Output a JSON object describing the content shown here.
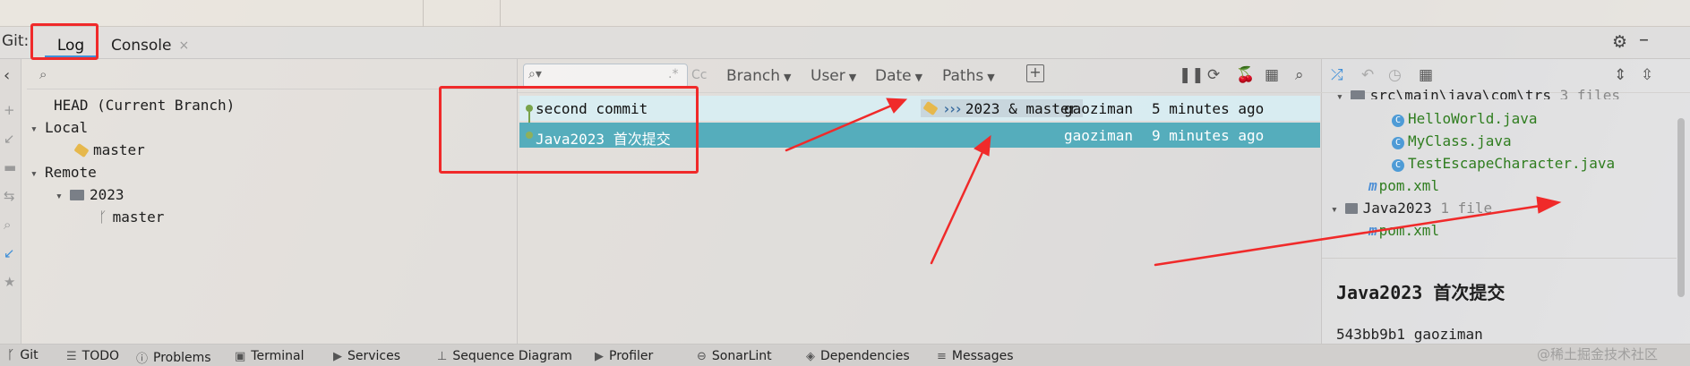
{
  "tool_window": {
    "label": "Git:",
    "tabs": [
      {
        "label": "Log",
        "active": true
      },
      {
        "label": "Console",
        "close": "×"
      }
    ]
  },
  "branches": {
    "head": "HEAD (Current Branch)",
    "local_label": "Local",
    "local_items": [
      "master"
    ],
    "remote_label": "Remote",
    "remote_groups": [
      {
        "name": "2023",
        "items": [
          "master"
        ]
      }
    ]
  },
  "log": {
    "filters": [
      "Branch",
      "User",
      "Date",
      "Paths"
    ],
    "search_icons": {
      "regex": ".*",
      "case": "Cc"
    },
    "commits": [
      {
        "subject": "second commit",
        "refs": "2023 & master",
        "author": "gaoziman",
        "date": "5 minutes ago",
        "selected": false
      },
      {
        "subject": "Java2023 首次提交",
        "refs": "",
        "author": "gaoziman",
        "date": "9 minutes ago",
        "selected": true
      }
    ]
  },
  "details": {
    "tree": {
      "path": "src\\main\\java\\com\\trs",
      "path_count": "3 files",
      "files": [
        "HelloWorld.java",
        "MyClass.java",
        "TestEscapeCharacter.java"
      ],
      "pom1": "pom.xml",
      "module": "Java2023",
      "module_count": "1 file",
      "pom2": "pom.xml"
    },
    "commit_title": "Java2023 首次提交",
    "commit_meta": "543bb9b1 gaoziman"
  },
  "statusbar": {
    "items": [
      "Git",
      "TODO",
      "Problems",
      "Terminal",
      "Services",
      "Sequence Diagram",
      "Profiler",
      "SonarLint",
      "Dependencies",
      "Messages"
    ]
  },
  "watermark": "@稀土掘金技术社区",
  "colors": {
    "accent": "#3f8fd8",
    "selected_row": "#55adbc",
    "annotation_red": "#f02a2a",
    "java_green": "#2f7d1f"
  }
}
